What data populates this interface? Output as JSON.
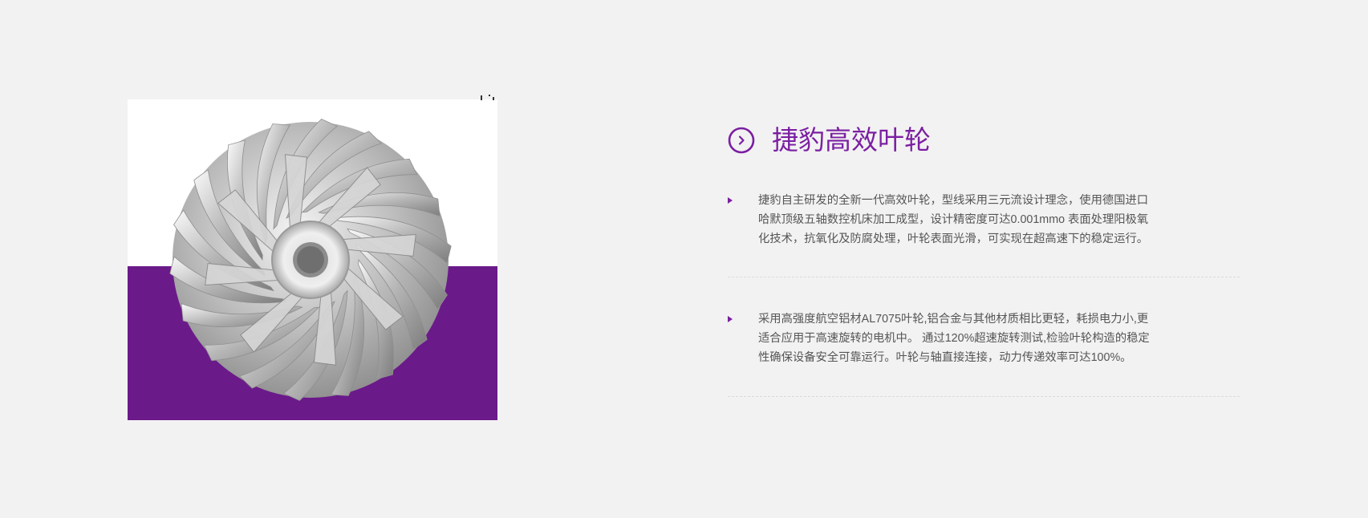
{
  "colors": {
    "background": "#f2f2f2",
    "accent": "#7b1fa2",
    "image_band": "#6b1a8a",
    "body_text": "#555555"
  },
  "product_image": {
    "subject": "turbo impeller",
    "icon": "impeller-illustration"
  },
  "header": {
    "icon": "circle-arrow-right-icon",
    "title": "捷豹高效叶轮"
  },
  "features": [
    {
      "icon": "triangle-bullet-icon",
      "lines": [
        "捷豹自主研发的全新一代高效叶轮，型线采用三元流设计理念，使用德国进口",
        "哈默顶级五轴数控机床加工成型，设计精密度可达0.001mmo 表面处理阳极氧",
        "化技术，抗氧化及防腐处理，叶轮表面光滑，可实现在超高速下的稳定运行。"
      ]
    },
    {
      "icon": "triangle-bullet-icon",
      "lines": [
        "采用高强度航空铝材AL7075叶轮,铝合金与其他材质相比更轻，耗损电力小,更",
        "适合应用于高速旋转的电机中。 通过120%超速旋转测试,检验叶轮构造的稳定",
        "性确保设备安全可靠运行。叶轮与轴直接连接，动力传递效率可达100%。"
      ]
    }
  ]
}
